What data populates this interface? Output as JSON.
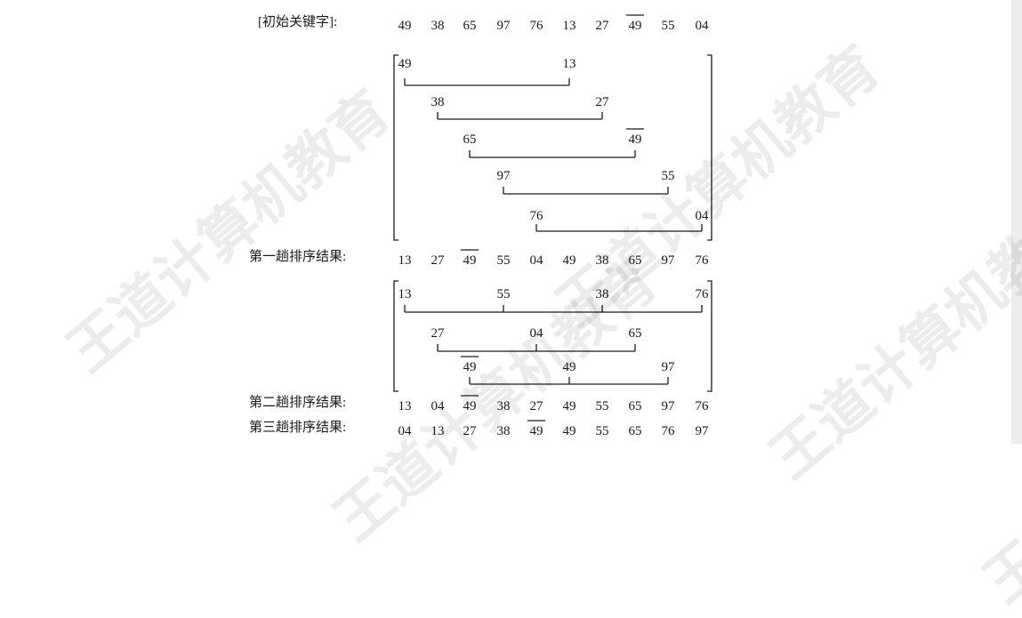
{
  "labels": {
    "initial": "[初始关键字]:",
    "pass1": "第一趟排序结果:",
    "pass2": "第二趟排序结果:",
    "pass3": "第三趟排序结果:"
  },
  "sequences": {
    "initial": [
      {
        "text": "49"
      },
      {
        "text": "38"
      },
      {
        "text": "65"
      },
      {
        "text": "97"
      },
      {
        "text": "76"
      },
      {
        "text": "13"
      },
      {
        "text": "27"
      },
      {
        "text": "49",
        "overline": true
      },
      {
        "text": "55"
      },
      {
        "text": "04"
      }
    ],
    "pass1": [
      {
        "text": "13"
      },
      {
        "text": "27"
      },
      {
        "text": "49",
        "overline": true
      },
      {
        "text": "55"
      },
      {
        "text": "04"
      },
      {
        "text": "49"
      },
      {
        "text": "38"
      },
      {
        "text": "65"
      },
      {
        "text": "97"
      },
      {
        "text": "76"
      }
    ],
    "pass2": [
      {
        "text": "13"
      },
      {
        "text": "04"
      },
      {
        "text": "49",
        "overline": true
      },
      {
        "text": "38"
      },
      {
        "text": "27"
      },
      {
        "text": "49"
      },
      {
        "text": "55"
      },
      {
        "text": "65"
      },
      {
        "text": "97"
      },
      {
        "text": "76"
      }
    ],
    "pass3": [
      {
        "text": "04"
      },
      {
        "text": "13"
      },
      {
        "text": "27"
      },
      {
        "text": "38"
      },
      {
        "text": "49",
        "overline": true
      },
      {
        "text": "49"
      },
      {
        "text": "55"
      },
      {
        "text": "65"
      },
      {
        "text": "76"
      },
      {
        "text": "97"
      }
    ]
  },
  "group1": [
    [
      {
        "text": "49"
      },
      {
        "text": "13"
      }
    ],
    [
      {
        "text": "38"
      },
      {
        "text": "27"
      }
    ],
    [
      {
        "text": "65"
      },
      {
        "text": "49",
        "overline": true
      }
    ],
    [
      {
        "text": "97"
      },
      {
        "text": "55"
      }
    ],
    [
      {
        "text": "76"
      },
      {
        "text": "04"
      }
    ]
  ],
  "group2": [
    [
      {
        "text": "13"
      },
      {
        "text": "55"
      },
      {
        "text": "38"
      },
      {
        "text": "76"
      }
    ],
    [
      {
        "text": "27"
      },
      {
        "text": "04"
      },
      {
        "text": "65"
      }
    ],
    [
      {
        "text": "49",
        "overline": true
      },
      {
        "text": "49"
      },
      {
        "text": "97"
      }
    ]
  ],
  "watermark": "王道计算机教育",
  "colors": {
    "ink": "#1a1a1a",
    "watermark": "#000000",
    "side_strip": "#ededed"
  }
}
